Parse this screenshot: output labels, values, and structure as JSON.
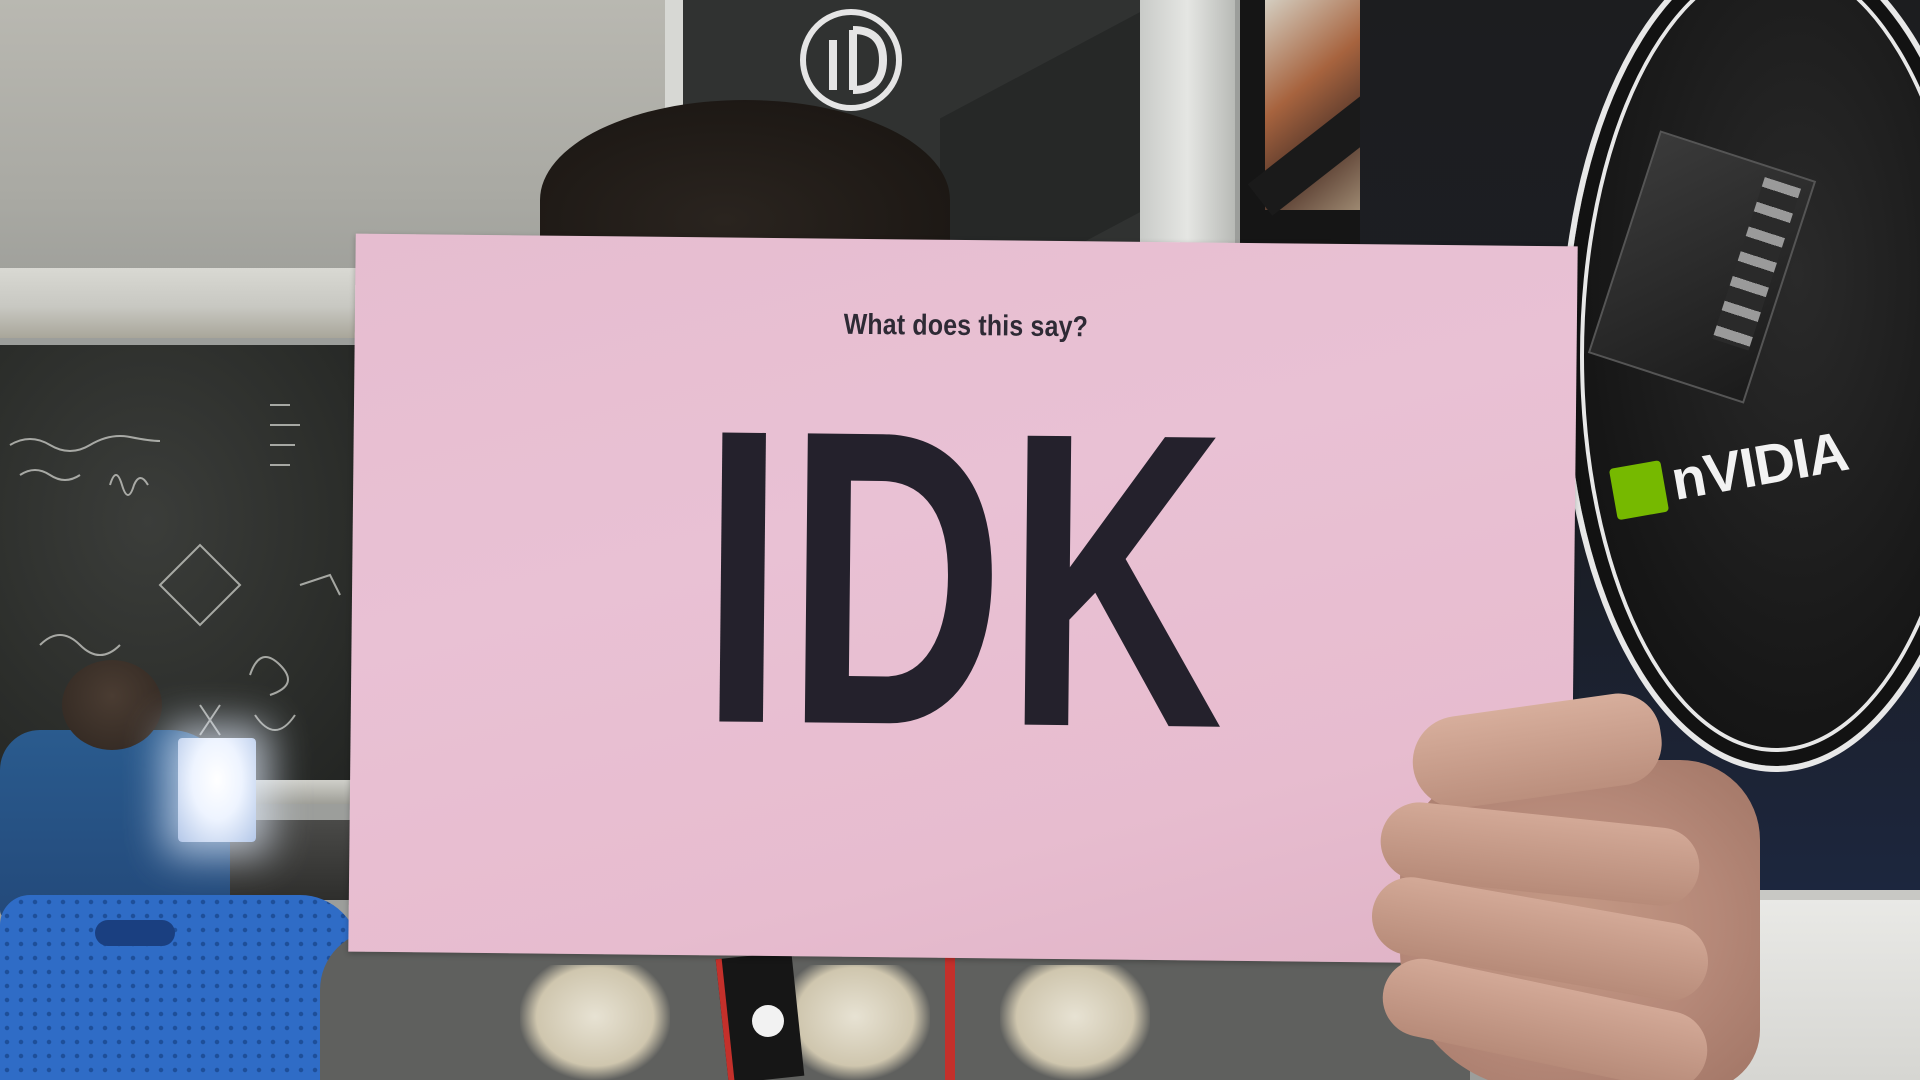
{
  "sign": {
    "question": "What does this say?",
    "answer": "IDK"
  },
  "poster": {
    "brand_text": "nVIDIA",
    "brand_color": "#76b900"
  },
  "colors": {
    "sign_paper": "#e8c0d3",
    "sign_ink": "#24212c",
    "chair_blue": "#2f6cc6",
    "shirt_gray": "#5f605e"
  }
}
